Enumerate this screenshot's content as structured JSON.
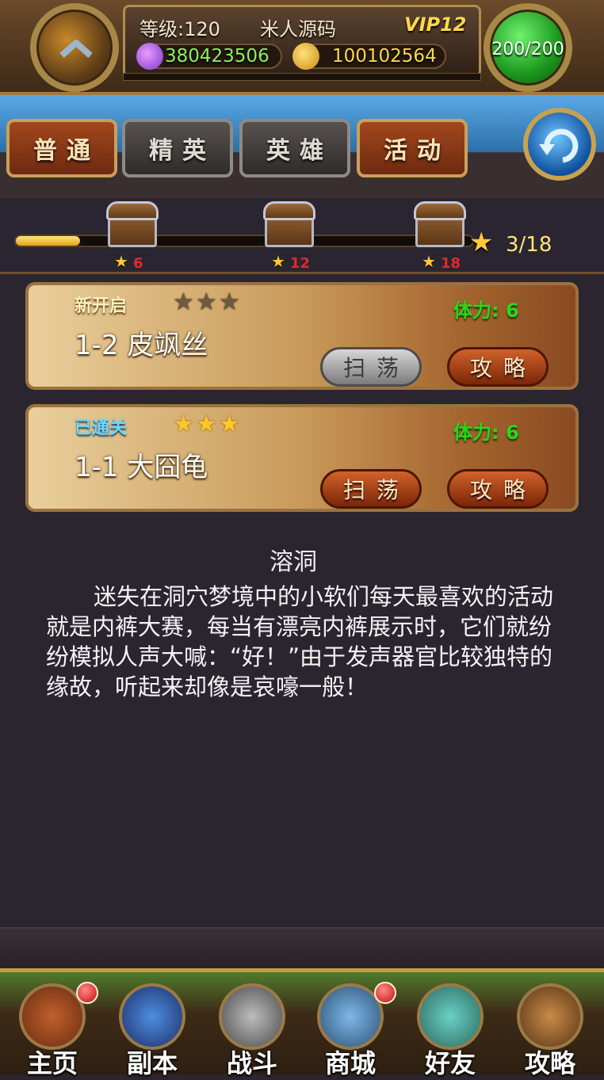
{
  "header": {
    "level_label": "等级:120",
    "player_name": "米人源码",
    "vip_label": "VIP12",
    "gems": "380423506",
    "coins": "100102564",
    "stamina": "200/200"
  },
  "tabs": [
    {
      "label": "普通"
    },
    {
      "label": "精英"
    },
    {
      "label": "英雄"
    },
    {
      "label": "活动"
    }
  ],
  "star_progress": {
    "progress_fraction": 0.14,
    "total_label": "3/18",
    "chests": [
      {
        "required": "6"
      },
      {
        "required": "12"
      },
      {
        "required": "18"
      }
    ]
  },
  "stages": [
    {
      "status": "新开启",
      "stars_earned": 0,
      "name": "1-2 皮飒丝",
      "cost": "体力: 6",
      "sweep_label": "扫荡",
      "guide_label": "攻略"
    },
    {
      "status": "已通关",
      "stars_earned": 3,
      "name": "1-1 大囧龟",
      "cost": "体力: 6",
      "sweep_label": "扫荡",
      "guide_label": "攻略"
    }
  ],
  "description": {
    "title": "溶洞",
    "body": "迷失在洞穴梦境中的小软们每天最喜欢的活动就是内裤大赛，每当有漂亮内裤展示时，它们就纷纷模拟人声大喊：“好！”由于发声器官比较独特的缘故，听起来却像是哀嚎一般！"
  },
  "nav": [
    {
      "label": "主页",
      "icon": "house-icon"
    },
    {
      "label": "副本",
      "icon": "skull-icon"
    },
    {
      "label": "战斗",
      "icon": "sword-icon"
    },
    {
      "label": "商城",
      "icon": "shop-monster-icon"
    },
    {
      "label": "好友",
      "icon": "friends-icon"
    },
    {
      "label": "攻略",
      "icon": "book-icon"
    }
  ]
}
